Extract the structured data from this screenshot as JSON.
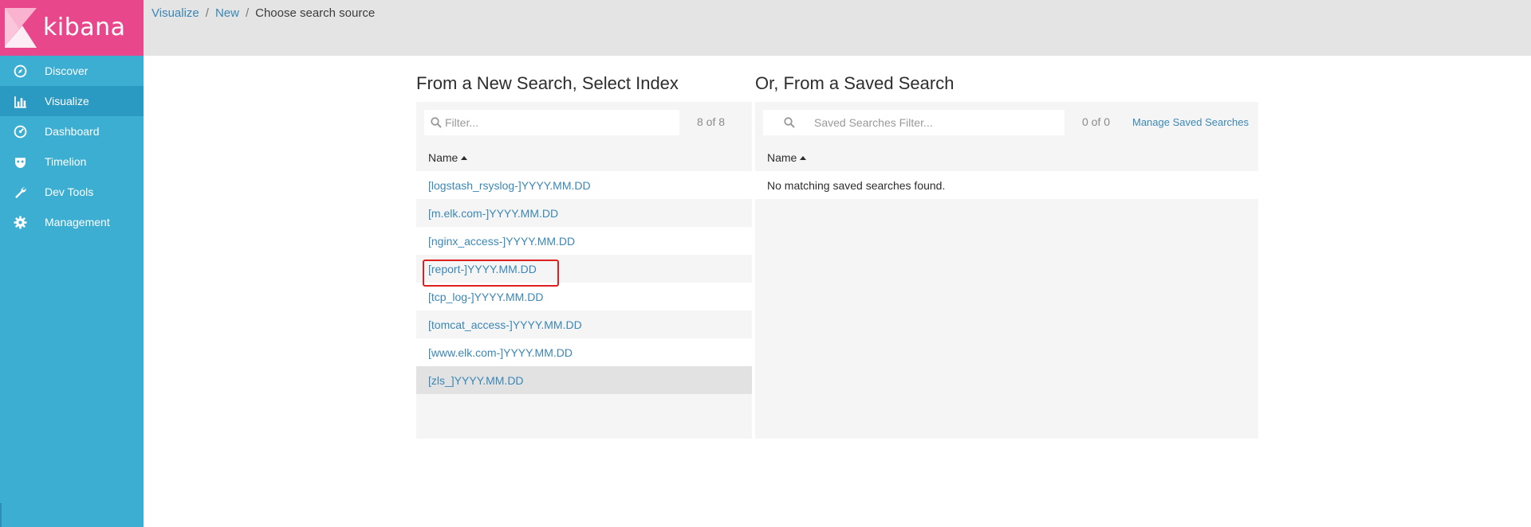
{
  "app": {
    "logo_text": "kibana"
  },
  "sidebar": {
    "items": [
      {
        "label": "Discover",
        "icon": "compass-icon"
      },
      {
        "label": "Visualize",
        "icon": "bar-chart-icon"
      },
      {
        "label": "Dashboard",
        "icon": "dashboard-gauge-icon"
      },
      {
        "label": "Timelion",
        "icon": "timelion-mask-icon"
      },
      {
        "label": "Dev Tools",
        "icon": "wrench-icon"
      },
      {
        "label": "Management",
        "icon": "gear-icon"
      }
    ],
    "active": "Visualize"
  },
  "breadcrumb": {
    "items": [
      "Visualize",
      "New"
    ],
    "separator": "/",
    "current": "Choose search source"
  },
  "new_search": {
    "title": "From a New Search, Select Index",
    "filter_placeholder": "Filter...",
    "count": "8 of 8",
    "column_header": "Name",
    "indices": [
      "[logstash_rsyslog-]YYYY.MM.DD",
      "[m.elk.com-]YYYY.MM.DD",
      "[nginx_access-]YYYY.MM.DD",
      "[report-]YYYY.MM.DD",
      "[tcp_log-]YYYY.MM.DD",
      "[tomcat_access-]YYYY.MM.DD",
      "[www.elk.com-]YYYY.MM.DD",
      "[zls_]YYYY.MM.DD"
    ],
    "highlighted_index": "[report-]YYYY.MM.DD",
    "hovered_index": "[zls_]YYYY.MM.DD"
  },
  "saved_search": {
    "title": "Or, From a Saved Search",
    "filter_placeholder": "Saved Searches Filter...",
    "count": "0 of 0",
    "manage_label": "Manage Saved Searches",
    "column_header": "Name",
    "empty_message": "No matching saved searches found."
  },
  "colors": {
    "sidebar": "#3caed2",
    "sidebar_active": "#2b9ac2",
    "logo_bg": "#e8488b",
    "link": "#3b87b5",
    "highlight": "#e02020"
  }
}
